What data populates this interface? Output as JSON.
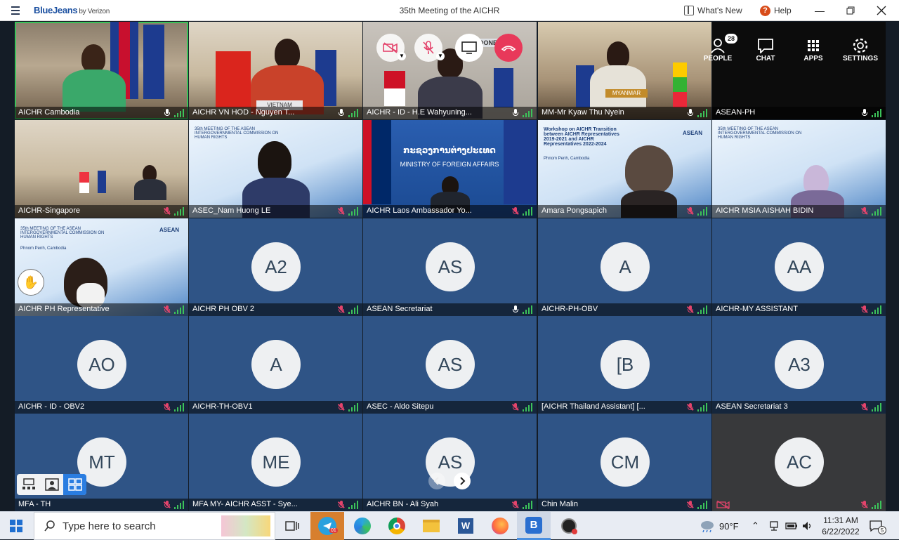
{
  "app": {
    "brand": "BlueJeans",
    "brand_suffix": "by Verizon",
    "title": "35th Meeting of the AICHR",
    "whats_new": "What's New",
    "help": "Help"
  },
  "controls": {
    "people_count": "28",
    "people_label": "PEOPLE",
    "chat_label": "CHAT",
    "apps_label": "APPS",
    "settings_label": "SETTINGS"
  },
  "tiles": [
    {
      "name": "AICHR Cambodia",
      "muted": false,
      "initials": ""
    },
    {
      "name": "AICHR VN HOD - Nguyen T...",
      "muted": false,
      "initials": ""
    },
    {
      "name": "AICHR - ID - H.E Wahyuning...",
      "muted": false,
      "initials": ""
    },
    {
      "name": "MM-Mr Kyaw Thu Nyein",
      "muted": false,
      "initials": ""
    },
    {
      "name": "ASEAN-PH",
      "muted": false,
      "initials": ""
    },
    {
      "name": "AICHR-Singapore",
      "muted": true,
      "initials": ""
    },
    {
      "name": "ASEC_Nam Huong LE",
      "muted": true,
      "initials": ""
    },
    {
      "name": "AICHR Laos Ambassador Yo...",
      "muted": true,
      "initials": ""
    },
    {
      "name": "Amara Pongsapich",
      "muted": true,
      "initials": ""
    },
    {
      "name": "AICHR MSIA AISHAH BIDIN",
      "muted": true,
      "initials": ""
    },
    {
      "name": "AICHR PH Representative",
      "muted": true,
      "initials": ""
    },
    {
      "name": "AICHR PH OBV 2",
      "muted": true,
      "initials": "A2"
    },
    {
      "name": "ASEAN Secretariat",
      "muted": false,
      "initials": "AS"
    },
    {
      "name": "AICHR-PH-OBV",
      "muted": true,
      "initials": "A"
    },
    {
      "name": "AICHR-MY ASSISTANT",
      "muted": true,
      "initials": "AA"
    },
    {
      "name": "AICHR - ID - OBV2",
      "muted": true,
      "initials": "AO"
    },
    {
      "name": "AICHR-TH-OBV1",
      "muted": true,
      "initials": "A"
    },
    {
      "name": "ASEC - Aldo Sitepu",
      "muted": true,
      "initials": "AS"
    },
    {
      "name": "[AICHR Thailand Assistant] [...",
      "muted": true,
      "initials": "[B"
    },
    {
      "name": "ASEAN Secretariat 3",
      "muted": true,
      "initials": "A3"
    },
    {
      "name": "MFA - TH",
      "muted": true,
      "initials": "MT"
    },
    {
      "name": "MFA MY- AICHR ASST - Sye...",
      "muted": true,
      "initials": "ME"
    },
    {
      "name": "AICHR BN - Ali Syah",
      "muted": true,
      "initials": "AS"
    },
    {
      "name": "Chin Malin",
      "muted": true,
      "initials": "CM"
    },
    {
      "name": "",
      "muted": true,
      "initials": "AC"
    }
  ],
  "slides": {
    "laos_banner": "ກະຊວງການຕ່າງປະເທດ",
    "laos_sub": "MINISTRY OF FOREIGN AFFAIRS",
    "workshop_title": "Workshop on AICHR Transition between AICHR Representatives 2019-2021 and AICHR Representatives 2022-2024",
    "workshop_place": "Phnom Penh, Cambodia",
    "meeting_title": "35th MEETING OF THE ASEAN INTERGOVERNMENTAL COMMISSION ON HUMAN RIGHTS",
    "meeting_place": "Phnom Penh, Cambodia",
    "asean_label": "ASEAN",
    "vn_plate": "VIETNAM",
    "id_plate": "INDONESIA",
    "mm_plate": "MYANMAR"
  },
  "taskbar": {
    "search_placeholder": "Type here to search",
    "temperature": "90°F",
    "time": "11:31 AM",
    "date": "6/22/2022",
    "notif_count": "5",
    "telegram_badge": "01"
  },
  "colors": {
    "tile_blue": "#2f5486",
    "active_outline": "#3cc35a",
    "hangup": "#e8395a",
    "muted": "#e4446c",
    "layout_selected": "#2a7de1"
  }
}
